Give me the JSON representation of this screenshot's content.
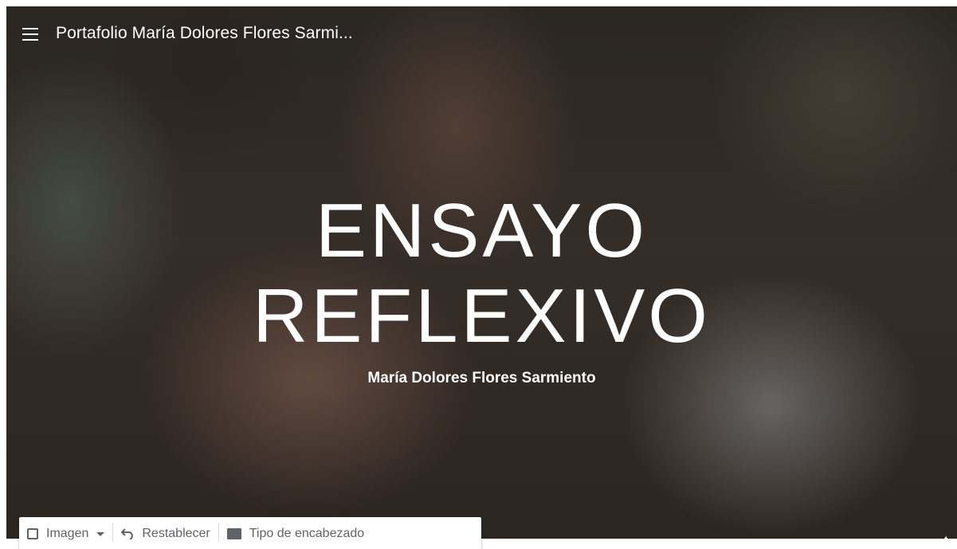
{
  "header": {
    "site_title": "Portafolio María Dolores Flores Sarmi..."
  },
  "hero": {
    "title_line1": "ENSAYO",
    "title_line2": "REFLEXIVO",
    "subtitle": "María Dolores Flores Sarmiento"
  },
  "toolbar": {
    "image_label": "Imagen",
    "reset_label": "Restablecer",
    "header_type_label": "Tipo de encabezado"
  },
  "icons": {
    "menu": "hamburger-menu-icon",
    "image": "image-icon",
    "dropdown": "chevron-down-icon",
    "reset": "undo-icon",
    "header_type": "header-type-icon"
  },
  "colors": {
    "title_text": "#ffffff",
    "toolbar_bg": "#ffffff",
    "toolbar_text": "#5f6368"
  }
}
